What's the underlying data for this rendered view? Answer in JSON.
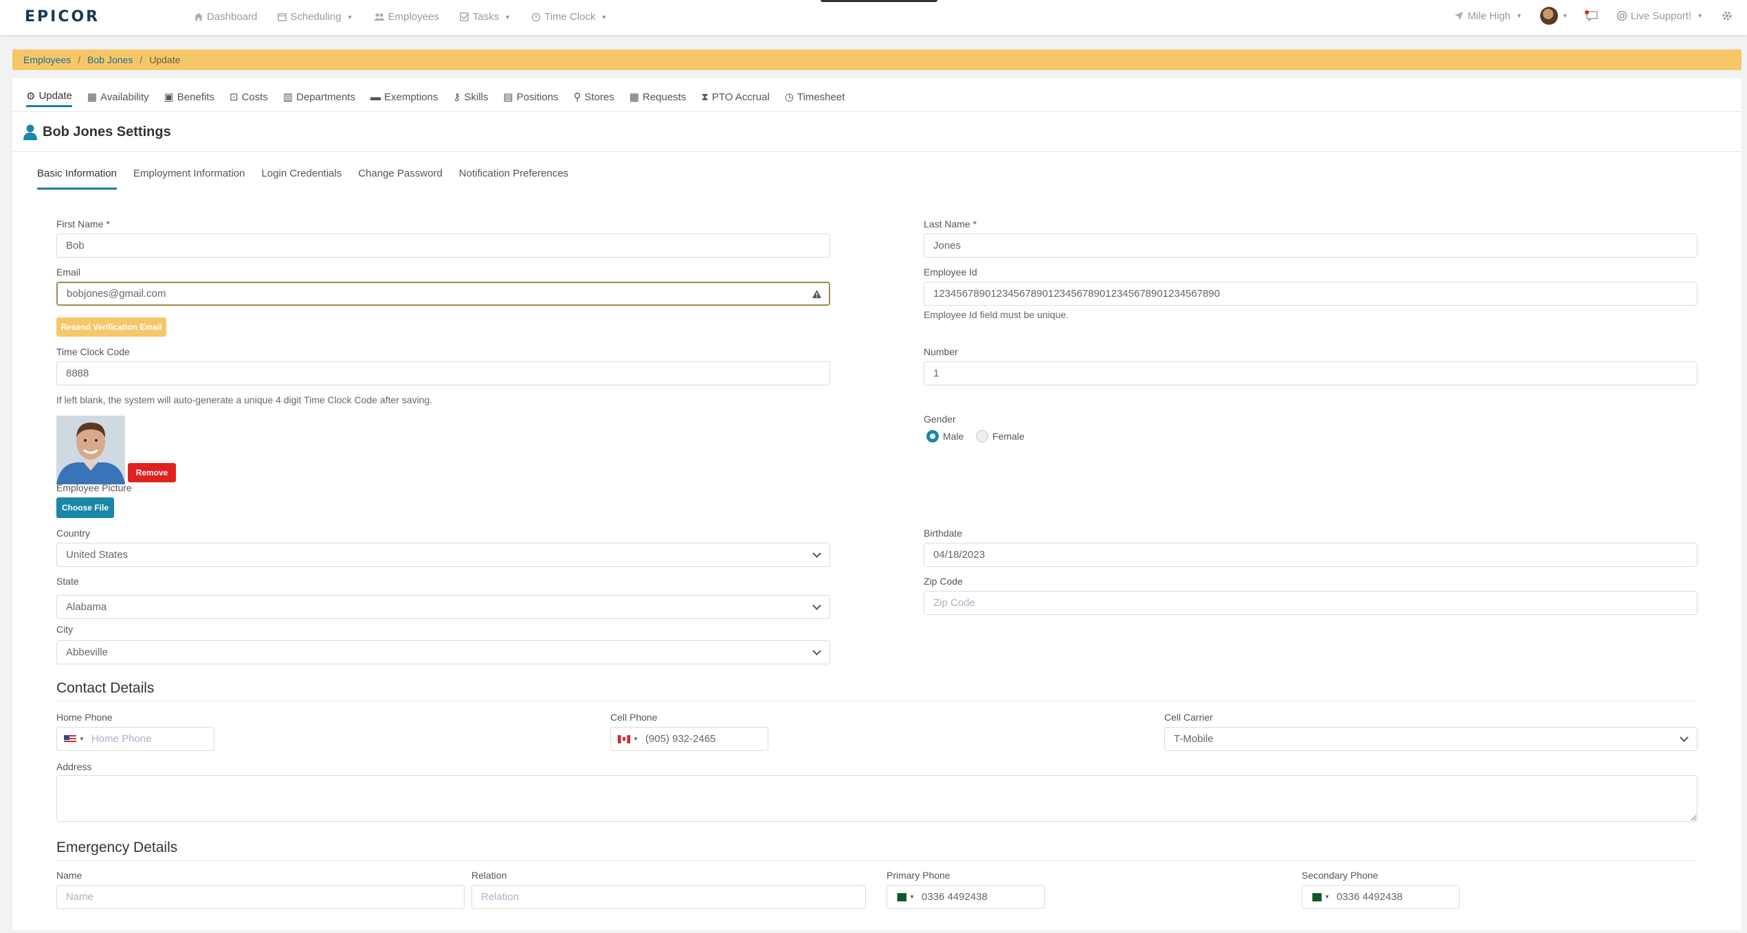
{
  "brand": "EPICOR",
  "nav": [
    {
      "icon": "home-icon",
      "label": "Dashboard",
      "caret": false
    },
    {
      "icon": "calendar-icon",
      "label": "Scheduling",
      "caret": true
    },
    {
      "icon": "users-icon",
      "label": "Employees",
      "caret": false
    },
    {
      "icon": "check-square-icon",
      "label": "Tasks",
      "caret": true
    },
    {
      "icon": "clock-icon",
      "label": "Time Clock",
      "caret": true
    }
  ],
  "topright": {
    "location": "Mile High",
    "support": "Live Support!"
  },
  "breadcrumb": {
    "employees": "Employees",
    "employee": "Bob Jones",
    "current": "Update"
  },
  "tabs": [
    {
      "icon": "cogs-icon",
      "label": "Update"
    },
    {
      "icon": "calendar-icon",
      "label": "Availability"
    },
    {
      "icon": "gift-icon",
      "label": "Benefits"
    },
    {
      "icon": "money-icon",
      "label": "Costs"
    },
    {
      "icon": "building-icon",
      "label": "Departments"
    },
    {
      "icon": "bed-icon",
      "label": "Exemptions"
    },
    {
      "icon": "key-icon",
      "label": "Skills"
    },
    {
      "icon": "briefcase-icon",
      "label": "Positions"
    },
    {
      "icon": "map-marker-icon",
      "label": "Stores"
    },
    {
      "icon": "calendar-icon",
      "label": "Requests"
    },
    {
      "icon": "hourglass-icon",
      "label": "PTO Accrual"
    },
    {
      "icon": "clock-icon",
      "label": "Timesheet"
    }
  ],
  "settings_title": "Bob Jones Settings",
  "subtabs": [
    "Basic Information",
    "Employment Information",
    "Login Credentials",
    "Change Password",
    "Notification Preferences"
  ],
  "form": {
    "first_name_label": "First Name *",
    "first_name": "Bob",
    "last_name_label": "Last Name *",
    "last_name": "Jones",
    "email_label": "Email",
    "email": "bobjones@gmail.com",
    "employee_id_label": "Employee Id",
    "employee_id": "12345678901234567890123456789012345678901234567890",
    "employee_id_help": "Employee Id field must be unique.",
    "resend_button": "Resend Verification Email",
    "time_clock_label": "Time Clock Code",
    "time_clock": "8888",
    "time_clock_help": "If left blank, the system will auto-generate a unique 4 digit Time Clock Code after saving.",
    "number_label": "Number",
    "number": "1",
    "gender_label": "Gender",
    "gender_male": "Male",
    "gender_female": "Female",
    "gender_selected": "Male",
    "remove_button": "Remove",
    "picture_label": "Employee Picture",
    "choose_file": "Choose File",
    "country_label": "Country",
    "country": "United States",
    "birthdate_label": "Birthdate",
    "birthdate": "04/18/2023",
    "state_label": "State",
    "state": "Alabama",
    "zip_label": "Zip Code",
    "zip_placeholder": "Zip Code",
    "city_label": "City",
    "city": "Abbeville"
  },
  "contact": {
    "title": "Contact Details",
    "home_phone_label": "Home Phone",
    "home_phone_placeholder": "Home Phone",
    "cell_phone_label": "Cell Phone",
    "cell_phone": "(905) 932-2465",
    "cell_carrier_label": "Cell Carrier",
    "cell_carrier": "T-Mobile",
    "address_label": "Address"
  },
  "emergency": {
    "title": "Emergency Details",
    "name_label": "Name",
    "name_placeholder": "Name",
    "relation_label": "Relation",
    "relation_placeholder": "Relation",
    "primary_label": "Primary Phone",
    "primary_phone": "0336 4492438",
    "secondary_label": "Secondary Phone",
    "secondary_phone": "0336 4492438"
  },
  "colors": {
    "accent": "#1a86a8",
    "warning": "#f6c768",
    "danger": "#e32020"
  }
}
